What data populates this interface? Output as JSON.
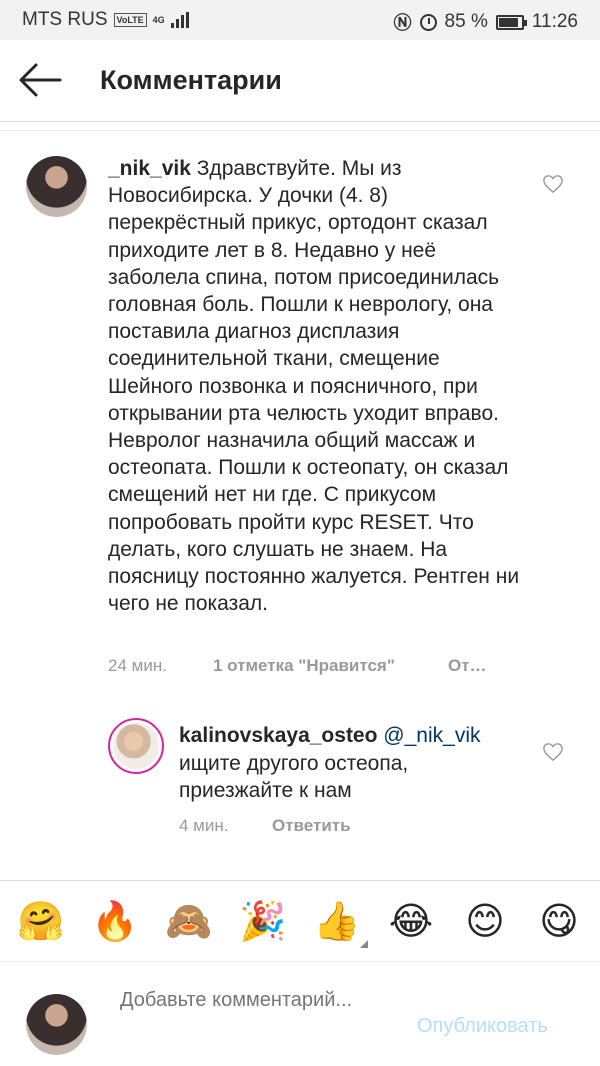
{
  "status_bar": {
    "carrier": "MTS RUS",
    "volte": "VoLTE",
    "network": "4G",
    "battery_percent": "85 %",
    "time": "11:26",
    "icons": [
      "signal-icon",
      "nfc-icon",
      "alarm-icon",
      "battery-icon"
    ]
  },
  "header": {
    "title": "Комментарии",
    "back_icon": "arrow-left-icon"
  },
  "comments": [
    {
      "username": "_nik_vik",
      "text": "Здравствуйте. Мы из Новосибирска. У дочки (4. 8) перекрёстный прикус, ортодонт сказал приходите лет в 8. Недавно у неё заболела спина, потом присоединилась головная боль. Пошли к неврологу, она поставила диагноз дисплазия соединительной ткани, смещение Шейного позвонка и поясничного, при открывании рта челюсть уходит вправо. Невролог назначила общий массаж и остеопата. Пошли к остеопату, он сказал смещений нет ни где. С прикусом попробовать пройти курс RESET. Что делать, кого слушать не знаем. На поясницу постоянно жалуется. Рентген ни чего не показал.",
      "time": "24 мин.",
      "likes": "1 отметка \"Нравится\"",
      "reply": "От…"
    },
    {
      "username": "kalinovskaya_osteo",
      "mention": "@_nik_vik",
      "text": "ищите другого остеопа, приезжайте к нам",
      "time": "4 мин.",
      "reply": "Ответить"
    }
  ],
  "emojis": [
    "🤗",
    "🔥",
    "🙈",
    "🎉",
    "👍",
    "😂",
    "😊",
    "😋"
  ],
  "composer": {
    "placeholder": "Добавьте комментарий...",
    "publish_label": "Опубликовать"
  },
  "colors": {
    "text": "#262626",
    "meta": "#999999",
    "mention": "#003569",
    "publish_disabled": "#b2dffc",
    "story_ring": "#d6249f"
  }
}
